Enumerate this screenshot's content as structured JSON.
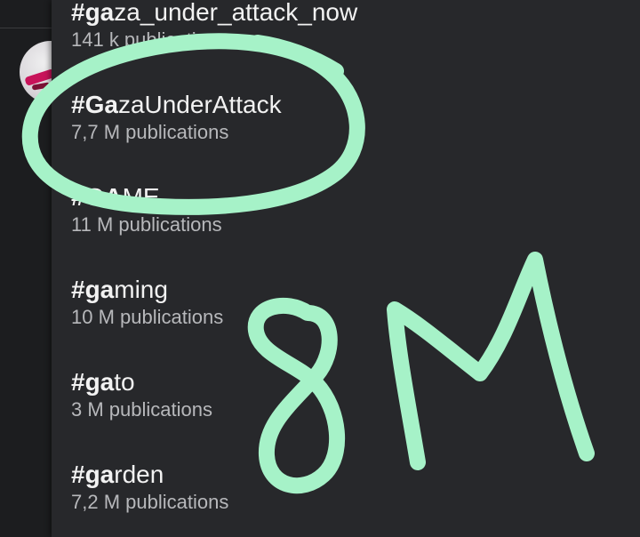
{
  "background": {
    "avatar_icon": "profile-avatar"
  },
  "suggestions": [
    {
      "match": "#ga",
      "rest": "za_under_attack_now",
      "count": "141 k publications"
    },
    {
      "match": "#Ga",
      "rest": "zaUnderAttack",
      "count": "7,7 M publications"
    },
    {
      "match": "#GA",
      "rest": "ME",
      "count": "11 M publications"
    },
    {
      "match": "#ga",
      "rest": "ming",
      "count": "10 M publications"
    },
    {
      "match": "#ga",
      "rest": "to",
      "count": "3 M publications"
    },
    {
      "match": "#ga",
      "rest": "rden",
      "count": "7,2 M publications"
    }
  ],
  "annotation": {
    "handwritten_text": "8M",
    "color": "#a6f2c8"
  },
  "colors": {
    "dropdown_bg": "#27282b",
    "page_bg": "#1c1d1f",
    "tag_text": "#f2f2f2",
    "count_text": "#b7b8bb"
  }
}
